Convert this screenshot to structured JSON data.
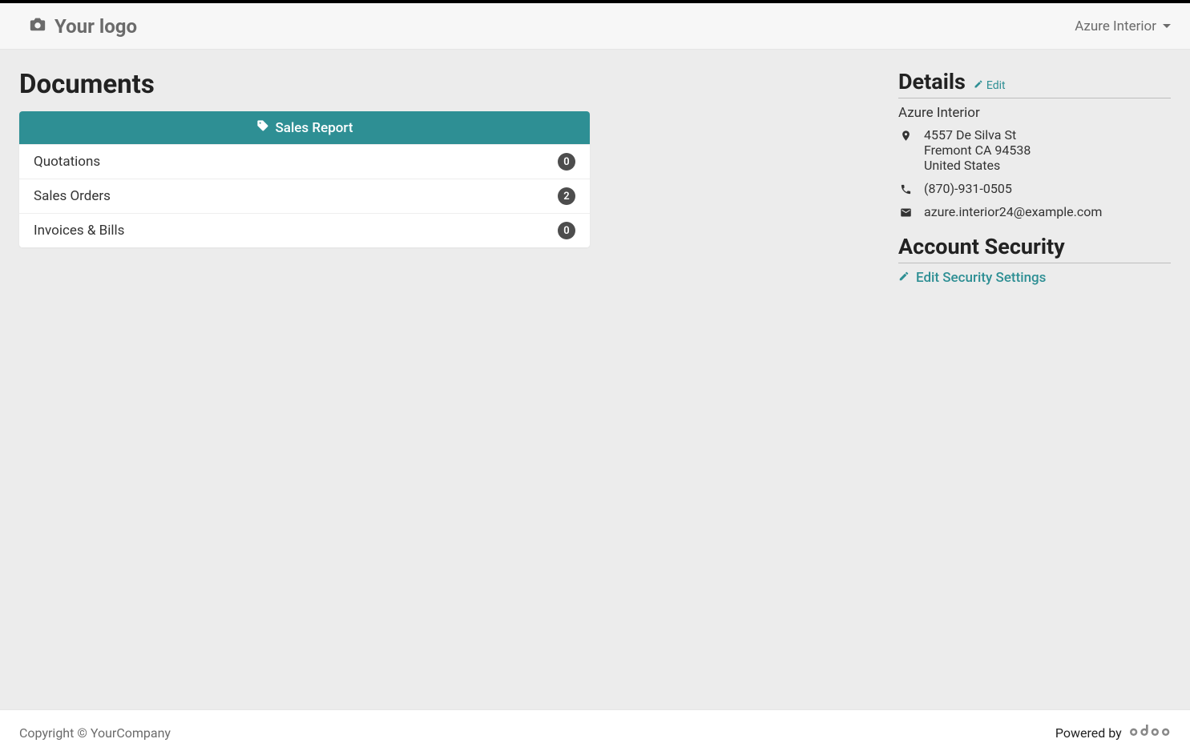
{
  "header": {
    "logo_text": "Your logo",
    "user_name": "Azure Interior"
  },
  "documents": {
    "title": "Documents",
    "sales_report_label": "Sales Report",
    "rows": [
      {
        "label": "Quotations",
        "count": "0"
      },
      {
        "label": "Sales Orders",
        "count": "2"
      },
      {
        "label": "Invoices & Bills",
        "count": "0"
      }
    ]
  },
  "details": {
    "title": "Details",
    "edit_label": "Edit",
    "company": "Azure Interior",
    "address_line1": "4557 De Silva St",
    "address_line2": "Fremont CA 94538",
    "address_line3": "United States",
    "phone": "(870)-931-0505",
    "email": "azure.interior24@example.com"
  },
  "security": {
    "title": "Account Security",
    "link_label": "Edit Security Settings"
  },
  "footer": {
    "copyright": "Copyright © YourCompany",
    "powered_by": "Powered by"
  }
}
